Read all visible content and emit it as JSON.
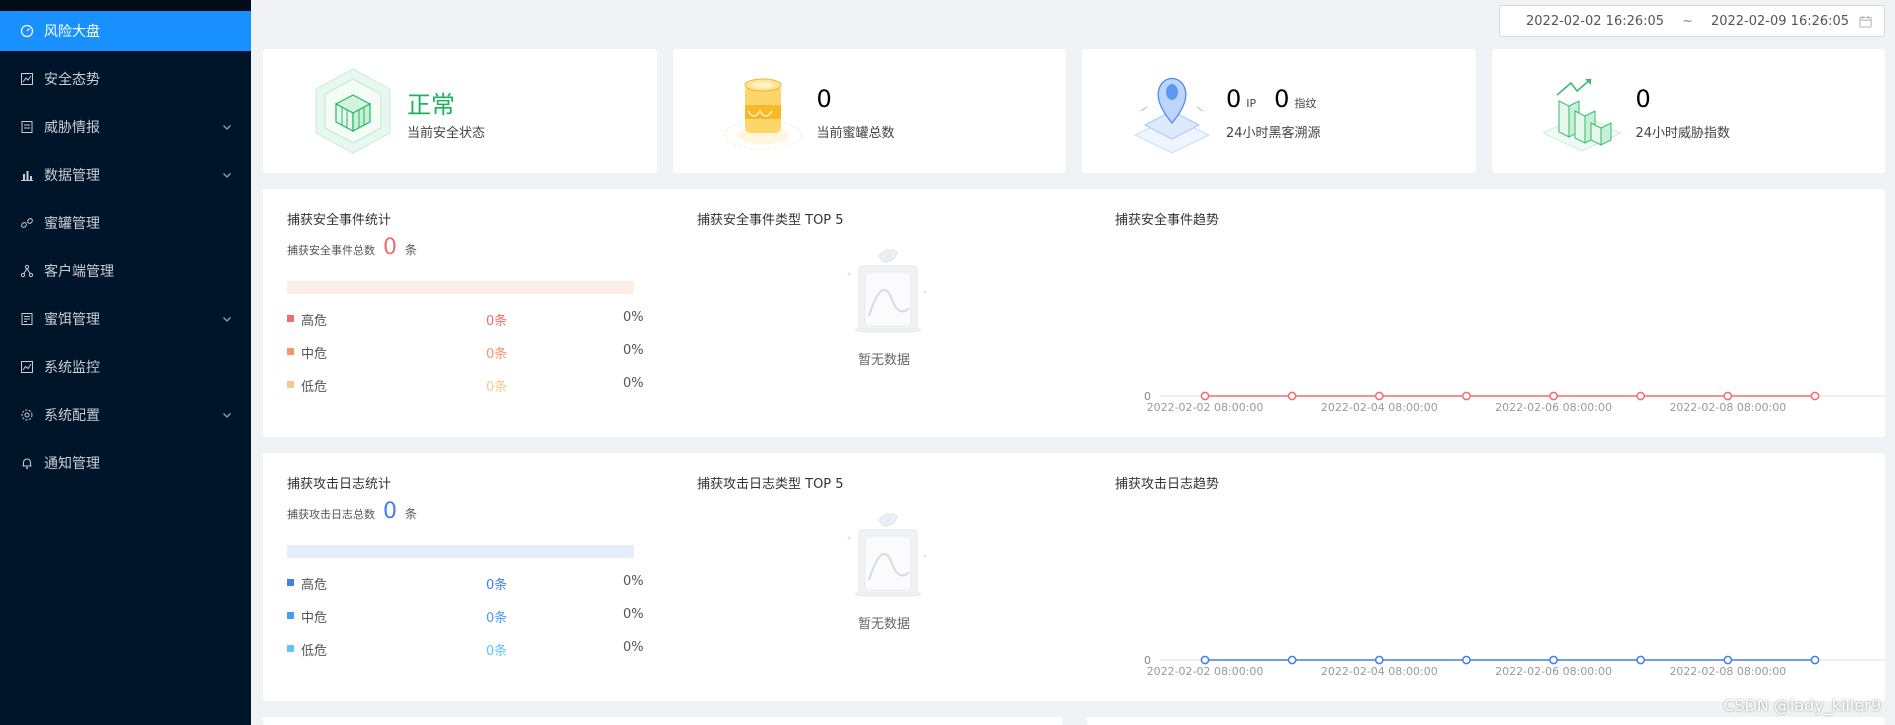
{
  "sidebar": {
    "items": [
      {
        "label": "风险大盘",
        "icon": "dashboard-icon",
        "active": true,
        "expandable": false
      },
      {
        "label": "安全态势",
        "icon": "line-chart-icon",
        "active": false,
        "expandable": false
      },
      {
        "label": "威胁情报",
        "icon": "document-icon",
        "active": false,
        "expandable": true
      },
      {
        "label": "数据管理",
        "icon": "bar-chart-icon",
        "active": false,
        "expandable": true
      },
      {
        "label": "蜜罐管理",
        "icon": "link-icon",
        "active": false,
        "expandable": false
      },
      {
        "label": "客户端管理",
        "icon": "network-icon",
        "active": false,
        "expandable": false
      },
      {
        "label": "蜜饵管理",
        "icon": "file-list-icon",
        "active": false,
        "expandable": true
      },
      {
        "label": "系统监控",
        "icon": "monitor-chart-icon",
        "active": false,
        "expandable": false
      },
      {
        "label": "系统配置",
        "icon": "gear-icon",
        "active": false,
        "expandable": true
      },
      {
        "label": "通知管理",
        "icon": "bell-icon",
        "active": false,
        "expandable": false
      }
    ]
  },
  "date_range": {
    "start": "2022-02-02 16:26:05",
    "separator": "~",
    "end": "2022-02-09 16:26:05"
  },
  "stat_cards": {
    "status": {
      "value": "正常",
      "label": "当前安全状态"
    },
    "honeypots": {
      "value": "0",
      "label": "当前蜜罐总数"
    },
    "trace": {
      "ip_value": "0",
      "ip_unit": "IP",
      "fp_value": "0",
      "fp_unit": "指纹",
      "label": "24小时黑客溯源"
    },
    "threat": {
      "value": "0",
      "label": "24小时威胁指数"
    }
  },
  "events_panel": {
    "stats_title": "捕获安全事件统计",
    "total_label": "捕获安全事件总数",
    "total_value": "0",
    "total_unit": "条",
    "severities": [
      {
        "name": "高危",
        "count": "0条",
        "percent": "0%"
      },
      {
        "name": "中危",
        "count": "0条",
        "percent": "0%"
      },
      {
        "name": "低危",
        "count": "0条",
        "percent": "0%"
      }
    ],
    "top5_title": "捕获安全事件类型 TOP 5",
    "no_data": "暂无数据",
    "trend_title": "捕获安全事件趋势"
  },
  "logs_panel": {
    "stats_title": "捕获攻击日志统计",
    "total_label": "捕获攻击日志总数",
    "total_value": "0",
    "total_unit": "条",
    "severities": [
      {
        "name": "高危",
        "count": "0条",
        "percent": "0%"
      },
      {
        "name": "中危",
        "count": "0条",
        "percent": "0%"
      },
      {
        "name": "低危",
        "count": "0条",
        "percent": "0%"
      }
    ],
    "top5_title": "捕获攻击日志类型 TOP 5",
    "no_data": "暂无数据",
    "trend_title": "捕获攻击日志趋势"
  },
  "colors": {
    "primary": "#1890ff",
    "sidebar_bg": "#001529",
    "normal_green": "#19b35b",
    "event_total": "#f56c6c",
    "event_high": "#f56c6c",
    "event_mid": "#f7946a",
    "event_low": "#f9c98a",
    "log_total": "#3f7ff0",
    "log_high": "#3f7ff0",
    "log_mid": "#4a9bf6",
    "log_low": "#5fc5f5"
  },
  "chart_data": [
    {
      "type": "line",
      "x": [
        "2022-02-02 08:00:00",
        "2022-02-03 08:00:00",
        "2022-02-04 08:00:00",
        "2022-02-05 08:00:00",
        "2022-02-06 08:00:00",
        "2022-02-07 08:00:00",
        "2022-02-08 08:00:00",
        "2022-02-09 08:00:00"
      ],
      "x_tick_labels": [
        "2022-02-02 08:00:00",
        "2022-02-04 08:00:00",
        "2022-02-06 08:00:00",
        "2022-02-08 08:00:00"
      ],
      "y_tick_labels": [
        "0"
      ],
      "series": [
        {
          "values": [
            0,
            0,
            0,
            0,
            0,
            0,
            0,
            0
          ],
          "color": "#f56c6c"
        }
      ],
      "grid": false,
      "legend": "none"
    },
    {
      "type": "line",
      "x": [
        "2022-02-02 08:00:00",
        "2022-02-03 08:00:00",
        "2022-02-04 08:00:00",
        "2022-02-05 08:00:00",
        "2022-02-06 08:00:00",
        "2022-02-07 08:00:00",
        "2022-02-08 08:00:00",
        "2022-02-09 08:00:00"
      ],
      "x_tick_labels": [
        "2022-02-02 08:00:00",
        "2022-02-04 08:00:00",
        "2022-02-06 08:00:00",
        "2022-02-08 08:00:00"
      ],
      "y_tick_labels": [
        "0"
      ],
      "series": [
        {
          "values": [
            0,
            0,
            0,
            0,
            0,
            0,
            0,
            0
          ],
          "color": "#3f7ff0"
        }
      ],
      "grid": false,
      "legend": "none"
    }
  ],
  "watermark": "CSDN @lady_killer9"
}
